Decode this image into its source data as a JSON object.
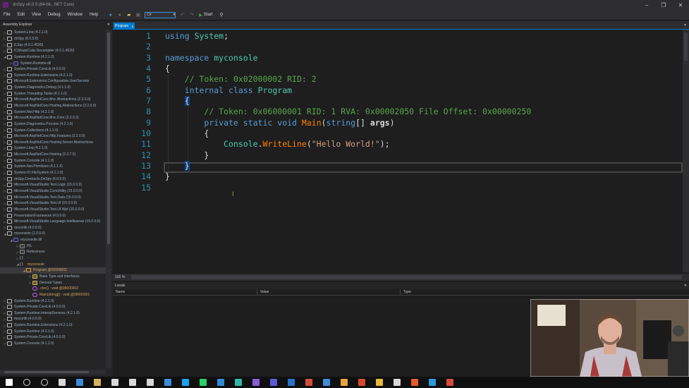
{
  "window": {
    "title": "dnSpy v6.0.5 (64-bit, .NET Core)",
    "controls": [
      "–",
      "❐",
      "✕"
    ]
  },
  "menu": {
    "items": [
      "File",
      "Edit",
      "View",
      "Debug",
      "Window",
      "Help"
    ]
  },
  "toolbar": {
    "language": "C#",
    "start_label": "Start"
  },
  "explorer": {
    "title": "Assembly Explorer",
    "close": "✕",
    "items": [
      {
        "text": "System.Linq (4.2.1.0)",
        "indent": 0,
        "exp": "▷",
        "icon": "asm"
      },
      {
        "text": "dnSpy (6.0.5.0)",
        "indent": 0,
        "exp": "▷",
        "icon": "asm"
      },
      {
        "text": "ILSpy (4.0.1.4530)",
        "indent": 0,
        "exp": "▷",
        "icon": "asm"
      },
      {
        "text": "ICSharpCode.Decompiler (4.0.1.4530)",
        "indent": 0,
        "exp": "▷",
        "icon": "asm"
      },
      {
        "text": "System.Runtime (4.2.1.0)",
        "indent": 0,
        "exp": "◢",
        "icon": "asm"
      },
      {
        "text": "System.Runtime.dll",
        "indent": 1,
        "exp": "▷",
        "icon": "mod"
      },
      {
        "text": "System.Private.CoreLib (4.0.0.0)",
        "indent": 0,
        "exp": "▷",
        "icon": "asm"
      },
      {
        "text": "System.Runtime.Extensions (4.2.1.0)",
        "indent": 0,
        "exp": "▷",
        "icon": "asm"
      },
      {
        "text": "Microsoft.Extensions.Configuration.UserSecrets",
        "indent": 0,
        "exp": "▷",
        "icon": "asm"
      },
      {
        "text": "System.Diagnostics.Debug (4.1.1.0)",
        "indent": 0,
        "exp": "▷",
        "icon": "asm"
      },
      {
        "text": "System.Threading.Tasks (4.1.1.0)",
        "indent": 0,
        "exp": "▷",
        "icon": "asm"
      },
      {
        "text": "Microsoft.AspNetCore.Mvc.Abstractions (2.2.0.0)",
        "indent": 0,
        "exp": "▷",
        "icon": "asm"
      },
      {
        "text": "Microsoft.AspNetCore.Hosting.Abstractions (2.2.0.0)",
        "indent": 0,
        "exp": "▷",
        "icon": "asm"
      },
      {
        "text": "System.Net.Http (4.2.1.0)",
        "indent": 0,
        "exp": "▷",
        "icon": "asm"
      },
      {
        "text": "Microsoft.AspNetCore.Mvc.Core (2.2.5.0)",
        "indent": 0,
        "exp": "▷",
        "icon": "asm"
      },
      {
        "text": "System.Diagnostics.Process (4.2.1.0)",
        "indent": 0,
        "exp": "▷",
        "icon": "asm"
      },
      {
        "text": "System.Collections (4.1.1.0)",
        "indent": 0,
        "exp": "▷",
        "icon": "asm"
      },
      {
        "text": "Microsoft.AspNetCore.Http.Features (2.2.0.0)",
        "indent": 0,
        "exp": "▷",
        "icon": "asm"
      },
      {
        "text": "Microsoft.AspNetCore.Hosting.Server.Abstractions",
        "indent": 0,
        "exp": "▷",
        "icon": "asm"
      },
      {
        "text": "System.Linq (4.2.1.0)",
        "indent": 0,
        "exp": "▷",
        "icon": "asm"
      },
      {
        "text": "Microsoft.AspNetCore.Hosting (2.2.7.0)",
        "indent": 0,
        "exp": "▷",
        "icon": "asm"
      },
      {
        "text": "System.Console (4.1.1.0)",
        "indent": 0,
        "exp": "▷",
        "icon": "asm"
      },
      {
        "text": "System.Net.Primitives (4.1.1.0)",
        "indent": 0,
        "exp": "▷",
        "icon": "asm"
      },
      {
        "text": "System.IO.FileSystem (4.1.1.0)",
        "indent": 0,
        "exp": "▷",
        "icon": "asm"
      },
      {
        "text": "dnSpy.Contracts.DnSpy (6.0.5.0)",
        "indent": 0,
        "exp": "▷",
        "icon": "asm"
      },
      {
        "text": "Microsoft.VisualStudio.Text.Logic (15.0.0.0)",
        "indent": 0,
        "exp": "▷",
        "icon": "asm"
      },
      {
        "text": "Microsoft.VisualStudio.CoreUtility (15.0.0.0)",
        "indent": 0,
        "exp": "▷",
        "icon": "asm"
      },
      {
        "text": "Microsoft.VisualStudio.Text.Data (15.0.0.0)",
        "indent": 0,
        "exp": "▷",
        "icon": "asm"
      },
      {
        "text": "Microsoft.VisualStudio.Text.UI (15.0.0.0)",
        "indent": 0,
        "exp": "▷",
        "icon": "asm"
      },
      {
        "text": "Microsoft.VisualStudio.Text.UI.Wpf (15.0.0.0)",
        "indent": 0,
        "exp": "▷",
        "icon": "asm"
      },
      {
        "text": "PresentationFramework (4.0.0.0)",
        "indent": 0,
        "exp": "▷",
        "icon": "asm"
      },
      {
        "text": "Microsoft.VisualStudio.Language.Intellisense (15.0.0.0)",
        "indent": 0,
        "exp": "▷",
        "icon": "asm"
      },
      {
        "text": "mscorlib (4.0.0.0)",
        "indent": 0,
        "exp": "▷",
        "icon": "asm"
      },
      {
        "text": "myconsole (1.0.0.0)",
        "indent": 0,
        "exp": "◢",
        "icon": "asm"
      },
      {
        "text": "myconsole.dll",
        "indent": 1,
        "exp": "◢",
        "icon": "mod"
      },
      {
        "text": "PE",
        "indent": 2,
        "exp": "▷",
        "icon": "fld"
      },
      {
        "text": "References",
        "indent": 2,
        "exp": "▷",
        "icon": "fld"
      },
      {
        "text": "-",
        "indent": 2,
        "exp": "▷",
        "icon": "ns"
      },
      {
        "text": "myconsole",
        "indent": 2,
        "exp": "◢",
        "icon": "ns"
      },
      {
        "text": "Program @02000002",
        "indent": 3,
        "exp": "◢",
        "icon": "cls",
        "selected": true
      },
      {
        "text": "Base Type and Interfaces",
        "indent": 4,
        "exp": "▷",
        "icon": "folder"
      },
      {
        "text": "Derived Types",
        "indent": 4,
        "exp": "▷",
        "icon": "folder"
      },
      {
        "text": ".ctor() : void @06000002",
        "indent": 4,
        "exp": "",
        "icon": "method"
      },
      {
        "text": "Main(string[]) : void @06000001",
        "indent": 4,
        "exp": "",
        "icon": "method"
      },
      {
        "text": "System.Runtime (4.2.1.0)",
        "indent": 0,
        "exp": "▷",
        "icon": "asm"
      },
      {
        "text": "System.Private.CoreLib (4.0.0.0)",
        "indent": 0,
        "exp": "▷",
        "icon": "asm"
      },
      {
        "text": "System.Runtime.InteropServices (4.2.1.0)",
        "indent": 0,
        "exp": "▷",
        "icon": "asm"
      },
      {
        "text": "mscorlib (4.0.0.0)",
        "indent": 0,
        "exp": "▷",
        "icon": "asm"
      },
      {
        "text": "System.Runtime.Extensions (4.2.1.0)",
        "indent": 0,
        "exp": "▷",
        "icon": "asm"
      },
      {
        "text": "System.Runtime (4.2.1.0)",
        "indent": 0,
        "exp": "▷",
        "icon": "asm"
      },
      {
        "text": "System.Private.CoreLib (4.0.0.0)",
        "indent": 0,
        "exp": "▷",
        "icon": "asm"
      },
      {
        "text": "System.Console (4.1.1.0)",
        "indent": 0,
        "exp": "▷",
        "icon": "asm"
      }
    ]
  },
  "editor": {
    "tab": "Program",
    "tab_close": "✕",
    "zoom": "100 %",
    "lines": [
      [
        [
          "kw",
          "using"
        ],
        [
          "pl",
          " "
        ],
        [
          "ty",
          "System"
        ],
        [
          "pl",
          ";"
        ]
      ],
      [],
      [
        [
          "kw",
          "namespace"
        ],
        [
          "pl",
          " "
        ],
        [
          "ty",
          "myconsole"
        ]
      ],
      [
        [
          "pl",
          "{"
        ]
      ],
      [
        [
          "pl",
          "    "
        ],
        [
          "cm",
          "// Token: 0x02000002 RID: 2"
        ]
      ],
      [
        [
          "pl",
          "    "
        ],
        [
          "kw",
          "internal"
        ],
        [
          "pl",
          " "
        ],
        [
          "kw",
          "class"
        ],
        [
          "pl",
          " "
        ],
        [
          "ty",
          "Program"
        ]
      ],
      [
        [
          "pl",
          "    "
        ],
        [
          "brace",
          "{"
        ]
      ],
      [
        [
          "pl",
          "        "
        ],
        [
          "cm",
          "// Token: 0x06000001 RID: 1 RVA: 0x00002050 File Offset: 0x00000250"
        ]
      ],
      [
        [
          "pl",
          "        "
        ],
        [
          "kw",
          "private"
        ],
        [
          "pl",
          " "
        ],
        [
          "kw",
          "static"
        ],
        [
          "pl",
          " "
        ],
        [
          "kw",
          "void"
        ],
        [
          "pl",
          " "
        ],
        [
          "mh",
          "Main"
        ],
        [
          "pl",
          "("
        ],
        [
          "kw",
          "string"
        ],
        [
          "pl",
          "[] "
        ],
        [
          "par",
          "args"
        ],
        [
          "pl",
          ")"
        ]
      ],
      [
        [
          "pl",
          "        {"
        ]
      ],
      [
        [
          "pl",
          "            "
        ],
        [
          "ty",
          "Console"
        ],
        [
          "pl",
          "."
        ],
        [
          "mh",
          "WriteLine"
        ],
        [
          "pl",
          "("
        ],
        [
          "st",
          "\"Hello World!\""
        ],
        [
          "pl",
          ");"
        ]
      ],
      [
        [
          "pl",
          "        }"
        ]
      ],
      [
        [
          "pl",
          "    "
        ],
        [
          "brace",
          "}"
        ]
      ],
      [
        [
          "pl",
          "}"
        ]
      ],
      []
    ]
  },
  "locals": {
    "title": "Locals",
    "close": "✕",
    "columns": [
      "Name",
      "Value",
      "Type"
    ]
  },
  "colors": {
    "accent": "#007acc",
    "keyword": "#569cd6",
    "type": "#4ec9b0",
    "comment": "#57a64a",
    "string": "#d69d85",
    "method": "#ff8000",
    "line_number": "#2b91af"
  },
  "taskbar": {
    "icons": [
      "windows-start-icon",
      "search-icon",
      "cortana-icon",
      "task-view-icon",
      "edge-icon",
      "file-explorer-icon",
      "store-icon",
      "mail-icon",
      "calendar-icon",
      "todo-icon",
      "twitter-icon",
      "whatsapp-icon",
      "vscode-icon",
      "vscode-insiders-icon",
      "visual-studio-icon",
      "teams-icon",
      "outlook-icon",
      "gmail-icon",
      "photos-icon",
      "chrome-icon",
      "powerpoint-icon",
      "chrome-canary-icon",
      "camera-icon",
      "office-icon",
      "camtasia-icon",
      "dnspy-icon"
    ]
  }
}
